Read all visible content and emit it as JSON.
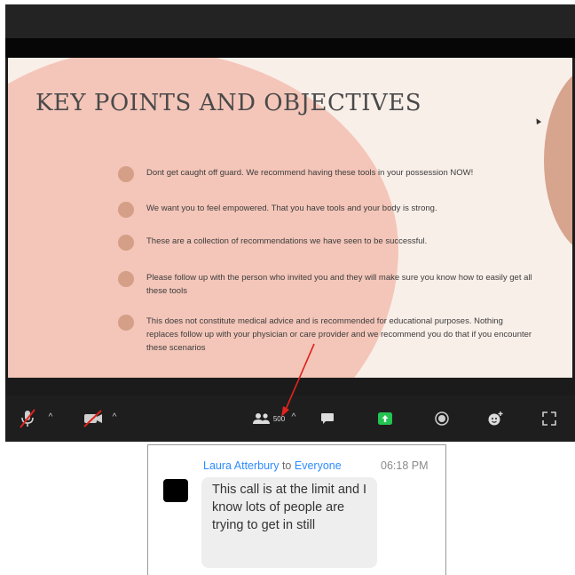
{
  "slide": {
    "title": "KEY POINTS AND OBJECTIVES",
    "bullets": [
      "Dont get caught off guard. We recommend having these tools in your possession NOW!",
      "We want you to feel empowered. That you have tools and your body is strong.",
      "These are a collection of recommendations we have seen to be successful.",
      "Please follow up with the person who invited you and they will make sure you know how to easily get all these tools",
      "This does not constitute medical advice and is recommended for educational purposes. Nothing replaces follow up with your physician or care provider and we recommend you do that if you encounter these scenarios"
    ]
  },
  "toolbar": {
    "participants_count": "500",
    "items": [
      "microphone-muted",
      "video-stopped",
      "participants",
      "chat",
      "share-screen",
      "record",
      "reactions",
      "fullscreen"
    ]
  },
  "chat": {
    "sender": "Laura Atterbury",
    "to_word": "to",
    "recipient": "Everyone",
    "time": "06:18 PM",
    "message": "This call is at the limit and I know lots of people are trying to get in still"
  },
  "colors": {
    "slide_background": "#f9efe9",
    "blob_pink": "#f4c6b9",
    "bullet_dot": "#d49f86",
    "annotation_arrow": "#e0231c",
    "share_green": "#23c451",
    "link_blue": "#2d8cff"
  }
}
